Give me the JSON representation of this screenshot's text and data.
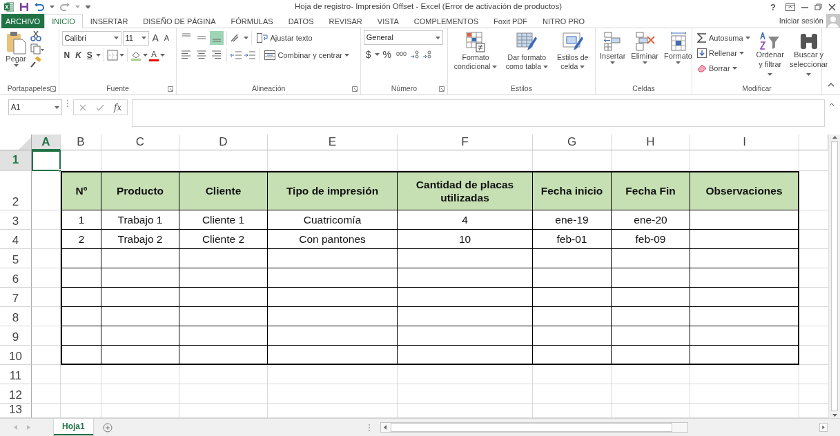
{
  "window": {
    "title": "Hoja de registro- Impresión Offset - Excel (Error de activación de productos)",
    "help": "?"
  },
  "tabs": [
    {
      "label": "ARCHIVO",
      "kind": "file",
      "selected": false
    },
    {
      "label": "INICIO",
      "kind": "tab",
      "selected": true
    },
    {
      "label": "INSERTAR",
      "kind": "tab",
      "selected": false
    },
    {
      "label": "DISEÑO DE PÁGINA",
      "kind": "tab",
      "selected": false
    },
    {
      "label": "FÓRMULAS",
      "kind": "tab",
      "selected": false
    },
    {
      "label": "DATOS",
      "kind": "tab",
      "selected": false
    },
    {
      "label": "REVISAR",
      "kind": "tab",
      "selected": false
    },
    {
      "label": "VISTA",
      "kind": "tab",
      "selected": false
    },
    {
      "label": "COMPLEMENTOS",
      "kind": "tab",
      "selected": false
    },
    {
      "label": "Foxit PDF",
      "kind": "tab",
      "selected": false
    },
    {
      "label": "NITRO PRO",
      "kind": "tab",
      "selected": false
    }
  ],
  "account": {
    "sign_in": "Iniciar sesión"
  },
  "ribbon": {
    "clipboard": {
      "label": "Portapapeles",
      "paste": "Pegar"
    },
    "font": {
      "label": "Fuente",
      "font_name": "Calibri",
      "font_size": "11",
      "grow": "A",
      "shrink": "A",
      "bold": "N",
      "italic": "K",
      "underline": "S",
      "font_color": "A"
    },
    "alignment": {
      "label": "Alineación",
      "vertical_buttons": [
        {
          "selected": false
        },
        {
          "selected": false
        },
        {
          "selected": true
        }
      ],
      "wrap_text": "Ajustar texto",
      "merge_center": "Combinar y centrar"
    },
    "number": {
      "label": "Número",
      "format": "General",
      "currency": "$",
      "percent": "%",
      "thousands": "000"
    },
    "styles": {
      "label": "Estilos",
      "buttons": [
        "Formato condicional",
        "Dar formato como tabla",
        "Estilos de celda"
      ]
    },
    "cells": {
      "label": "Celdas",
      "buttons": [
        "Insertar",
        "Eliminar",
        "Formato"
      ]
    },
    "editing": {
      "label": "Modificar",
      "autosum": "Autosuma",
      "fill": "Rellenar",
      "clear": "Borrar",
      "sort": "Ordenar y filtrar",
      "find": "Buscar y seleccionar"
    }
  },
  "formula_bar": {
    "name_box": "A1",
    "function_label": "fx"
  },
  "sheet": {
    "columns": [
      {
        "label": "A",
        "selected": true
      },
      {
        "label": "B",
        "selected": false
      },
      {
        "label": "C",
        "selected": false
      },
      {
        "label": "D",
        "selected": false
      },
      {
        "label": "E",
        "selected": false
      },
      {
        "label": "F",
        "selected": false
      },
      {
        "label": "G",
        "selected": false
      },
      {
        "label": "H",
        "selected": false
      },
      {
        "label": "I",
        "selected": false
      }
    ],
    "rows": [
      {
        "number": "1",
        "selected": true,
        "kind": "plain"
      },
      {
        "number": "2",
        "selected": false,
        "kind": "header",
        "cells": [
          "Nº",
          "Producto",
          "Cliente",
          "Tipo de impresión",
          "Cantidad de placas utilizadas",
          "Fecha inicio",
          "Fecha Fin",
          "Observaciones"
        ]
      },
      {
        "number": "3",
        "selected": false,
        "kind": "data",
        "cells": [
          "1",
          "Trabajo 1",
          "Cliente 1",
          "Cuatricomía",
          "4",
          "ene-19",
          "ene-20"
        ]
      },
      {
        "number": "4",
        "selected": false,
        "kind": "data",
        "cells": [
          "2",
          "Trabajo 2",
          "Cliente 2",
          "Con pantones",
          "10",
          "feb-01",
          "feb-09"
        ]
      },
      {
        "number": "5",
        "selected": false,
        "kind": "blank"
      },
      {
        "number": "6",
        "selected": false,
        "kind": "blank"
      },
      {
        "number": "7",
        "selected": false,
        "kind": "blank"
      },
      {
        "number": "8",
        "selected": false,
        "kind": "blank"
      },
      {
        "number": "9",
        "selected": false,
        "kind": "blank"
      },
      {
        "number": "10",
        "selected": false,
        "kind": "blank"
      },
      {
        "number": "11",
        "selected": false,
        "kind": "plain"
      },
      {
        "number": "12",
        "selected": false,
        "kind": "plain"
      },
      {
        "number": "13",
        "selected": false,
        "kind": "plain"
      }
    ]
  },
  "sheet_tabs": [
    {
      "label": "Hoja1",
      "selected": true
    }
  ]
}
